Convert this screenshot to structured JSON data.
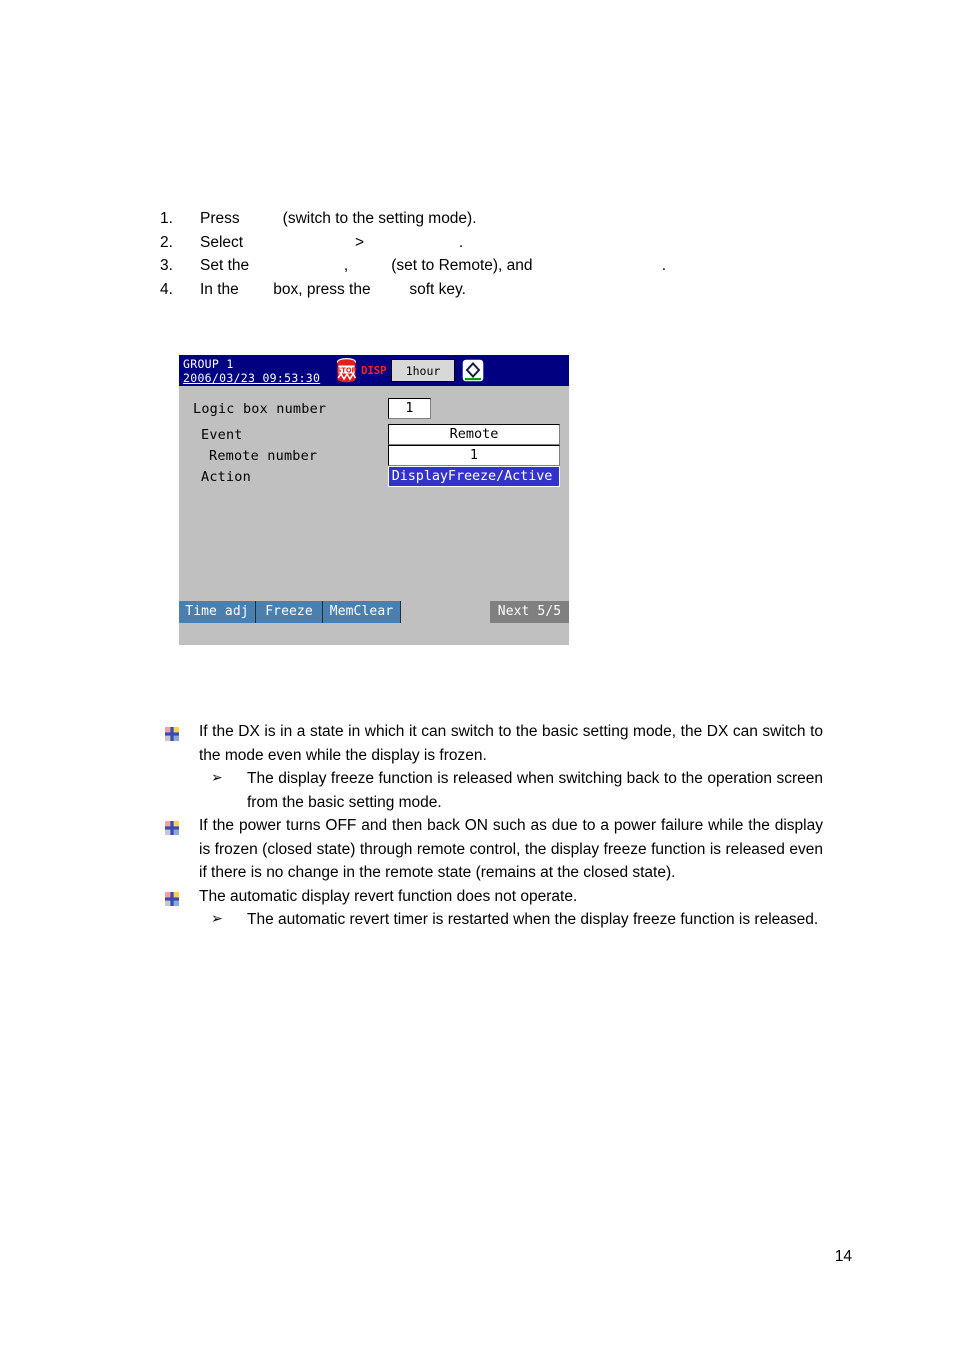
{
  "steps": [
    {
      "num": "1.",
      "text": "Press          (switch to the setting mode)."
    },
    {
      "num": "2.",
      "text": "Select                          >                      ."
    },
    {
      "num": "3.",
      "text": "Set the                      ,          (set to Remote), and                              ."
    },
    {
      "num": "4.",
      "text": "In the        box, press the         soft key."
    }
  ],
  "device": {
    "header": {
      "group": "GROUP 1",
      "datetime": "2006/03/23 09:53:30",
      "stop_icon": "stop-recorder-icon",
      "disp_label": "DISP",
      "timescale": "1hour",
      "status_icon": "media-status-icon"
    },
    "fields": [
      {
        "label": "Logic box number",
        "value": "1",
        "selected": false
      },
      {
        "label": "Event",
        "value": "Remote",
        "selected": false
      },
      {
        "label": "Remote number",
        "value": "1",
        "selected": false
      },
      {
        "label": "Action",
        "value": "DisplayFreeze/Active",
        "selected": true
      }
    ],
    "softkeys": [
      {
        "label": "Time adj",
        "kind": "blue"
      },
      {
        "label": "Freeze",
        "kind": "blue"
      },
      {
        "label": "MemClear",
        "kind": "blue"
      },
      {
        "label": "Next 5/5",
        "kind": "gray"
      }
    ],
    "colors": {
      "header_bg": "#000080",
      "body_bg": "#c0c0c0",
      "selection": "#3333cc",
      "softkey": "#4a7fae",
      "softkey_next": "#808080",
      "disp_red": "#ff2020"
    }
  },
  "notes": [
    {
      "bullet": "cross-icon",
      "text": "If the DX is in a state in which it can switch to the basic setting mode, the DX can switch to the mode even while the display is frozen.",
      "sub": [
        {
          "marker": "➢",
          "text": "The display freeze function is released when switching back to the operation screen from the basic setting mode."
        }
      ]
    },
    {
      "bullet": "cross-icon",
      "text": "If the power turns OFF and then back ON such as due to a power failure while the display is frozen (closed state) through remote control, the display freeze function is released even if there is no change in the remote state (remains at the closed state).",
      "sub": []
    },
    {
      "bullet": "cross-icon",
      "text": "The automatic display revert function does not operate.",
      "sub": [
        {
          "marker": "➢",
          "text": "The automatic revert timer is restarted when the display freeze function is released."
        }
      ]
    }
  ],
  "page_number": "14"
}
